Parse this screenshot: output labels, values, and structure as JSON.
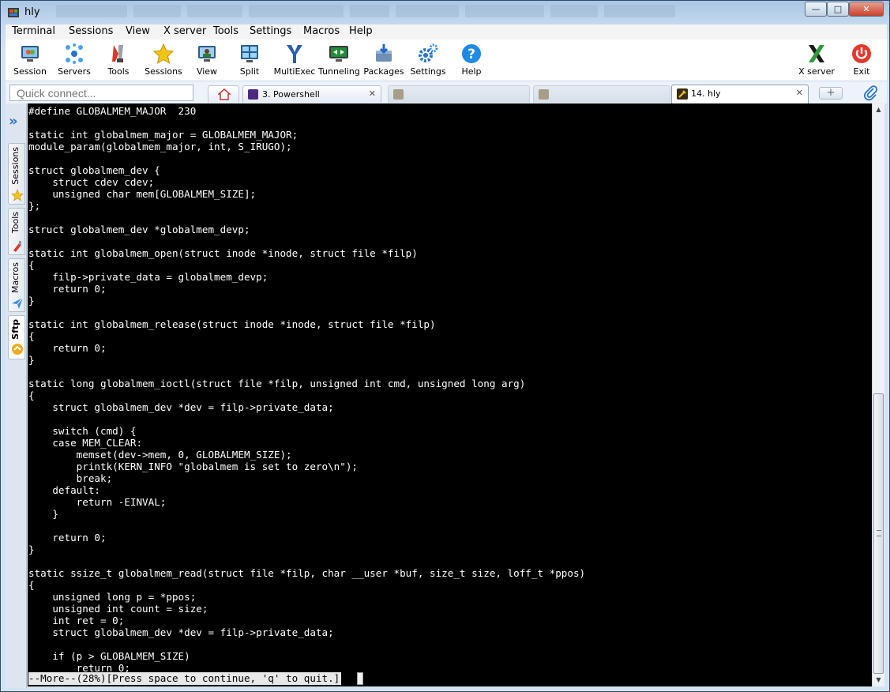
{
  "window": {
    "title": "hly",
    "ctrl_min": "—",
    "ctrl_max": "□",
    "ctrl_close": "✕"
  },
  "menu": [
    "Terminal",
    "Sessions",
    "View",
    "X server",
    "Tools",
    "Settings",
    "Macros",
    "Help"
  ],
  "toolbar": {
    "session": "Session",
    "servers": "Servers",
    "tools": "Tools",
    "sessions": "Sessions",
    "view": "View",
    "split": "Split",
    "multiexec": "MultiExec",
    "tunneling": "Tunneling",
    "packages": "Packages",
    "settings": "Settings",
    "help": "Help",
    "xserver": "X server",
    "exit": "Exit"
  },
  "quick_connect": {
    "placeholder": "Quick connect..."
  },
  "tabs": {
    "powershell": "3. Powershell",
    "hly": "14. hly",
    "close": "✕",
    "new": "+"
  },
  "sidebar": {
    "expand": "»",
    "sessions": "Sessions",
    "tools": "Tools",
    "macros": "Macros",
    "sftp": "Sftp"
  },
  "terminal": {
    "code": "#define GLOBALMEM_MAJOR  230\n\nstatic int globalmem_major = GLOBALMEM_MAJOR;\nmodule_param(globalmem_major, int, S_IRUGO);\n\nstruct globalmem_dev {\n    struct cdev cdev;\n    unsigned char mem[GLOBALMEM_SIZE];\n};\n\nstruct globalmem_dev *globalmem_devp;\n\nstatic int globalmem_open(struct inode *inode, struct file *filp)\n{\n    filp->private_data = globalmem_devp;\n    return 0;\n}\n\nstatic int globalmem_release(struct inode *inode, struct file *filp)\n{\n    return 0;\n}\n\nstatic long globalmem_ioctl(struct file *filp, unsigned int cmd, unsigned long arg)\n{\n    struct globalmem_dev *dev = filp->private_data;\n\n    switch (cmd) {\n    case MEM_CLEAR:\n        memset(dev->mem, 0, GLOBALMEM_SIZE);\n        printk(KERN_INFO \"globalmem is set to zero\\n\");\n        break;\n    default:\n        return -EINVAL;\n    }\n\n    return 0;\n}\n\nstatic ssize_t globalmem_read(struct file *filp, char __user *buf, size_t size, loff_t *ppos)\n{\n    unsigned long p = *ppos;\n    unsigned int count = size;\n    int ret = 0;\n    struct globalmem_dev *dev = filp->private_data;\n\n    if (p > GLOBALMEM_SIZE)\n        return 0;",
    "pager": "--More--(28%)[Press space to continue, 'q' to quit.]"
  },
  "scrollbar": {
    "up": "▲",
    "down": "▼",
    "position_percent": 28
  },
  "colors": {
    "terminal_bg": "#000000",
    "terminal_fg": "#ffffff",
    "accent": "#2a74c7",
    "exit_red": "#e2392b",
    "help_blue": "#1e8ae6"
  }
}
